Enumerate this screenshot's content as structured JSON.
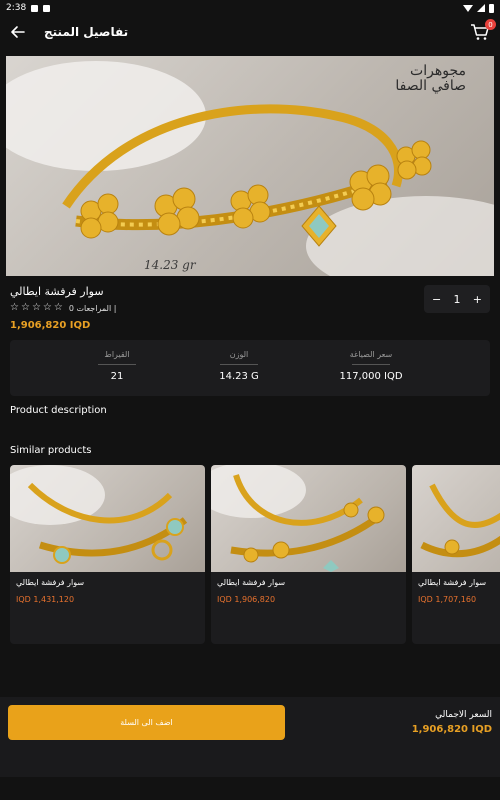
{
  "status_bar": {
    "time": "2:38"
  },
  "app_bar": {
    "title": "تفاصيل المنتج",
    "cart_count": "0"
  },
  "hero": {
    "logo_line1": "مجوهرات",
    "logo_line2": "صافي الصفا",
    "weight_caption": "14.23 gr"
  },
  "product": {
    "name": "سوار فرفشة ايطالي",
    "reviews_label": "المراجعات 0 |",
    "price": "1,906,820 IQD",
    "quantity": "1",
    "rating_stars": 0
  },
  "specs": [
    {
      "label": "القيراط",
      "value": "21"
    },
    {
      "label": "الوزن",
      "value": "14.23 G"
    },
    {
      "label": "سعر الصياغة",
      "value": "117,000 IQD"
    }
  ],
  "sections": {
    "description": "Product description",
    "similar": "Similar products"
  },
  "similar_products": [
    {
      "name": "سوار فرفشة ايطالي",
      "price": "IQD 1,431,120"
    },
    {
      "name": "سوار فرفشة ايطالي",
      "price": "IQD 1,906,820"
    },
    {
      "name": "سوار فرفشة ايطالي",
      "price": "IQD 1,707,160"
    }
  ],
  "bottom_bar": {
    "add_to_cart": "اضف الى السلة",
    "total_label": "السعر الاجمالي",
    "total_value": "1,906,820 IQD"
  },
  "colors": {
    "background": "#121212",
    "accent": "#e9a21a",
    "price": "#e8a024",
    "card": "#1c1c1e",
    "badge": "#e8413b"
  },
  "icons": [
    "back-arrow-icon",
    "cart-icon",
    "star-outline-icon",
    "minus-icon",
    "plus-icon"
  ]
}
